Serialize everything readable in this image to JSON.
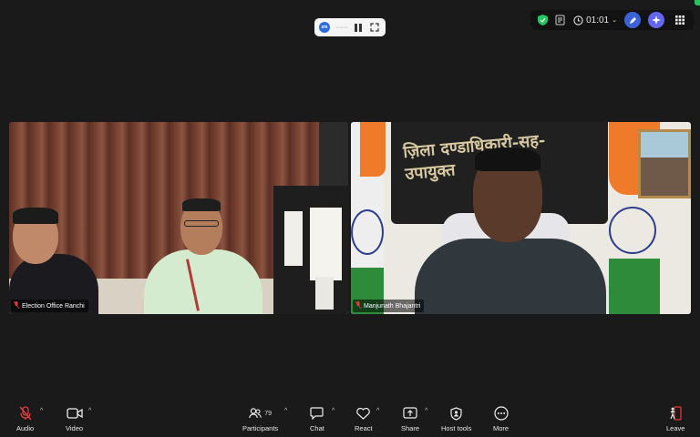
{
  "recording": {
    "logo": "zm",
    "dots": "··········"
  },
  "top_right": {
    "timer": "01:01"
  },
  "tiles": {
    "left": {
      "name": "Election Office Ranchi"
    },
    "right": {
      "name": "Manjunath Bhajantri",
      "banner_text": "ज़िला दण्डाधिकारी-सह-उपायुक्त"
    }
  },
  "toolbar": {
    "audio": "Audio",
    "video": "Video",
    "participants": "Participants",
    "participant_count": "79",
    "chat": "Chat",
    "react": "React",
    "share": "Share",
    "host_tools": "Host tools",
    "more": "More",
    "leave": "Leave"
  },
  "colors": {
    "accent_blue": "#2d6cdf",
    "muted_red": "#e23c3c",
    "shield_green": "#22c55e",
    "ai_purple": "#6366f1"
  }
}
